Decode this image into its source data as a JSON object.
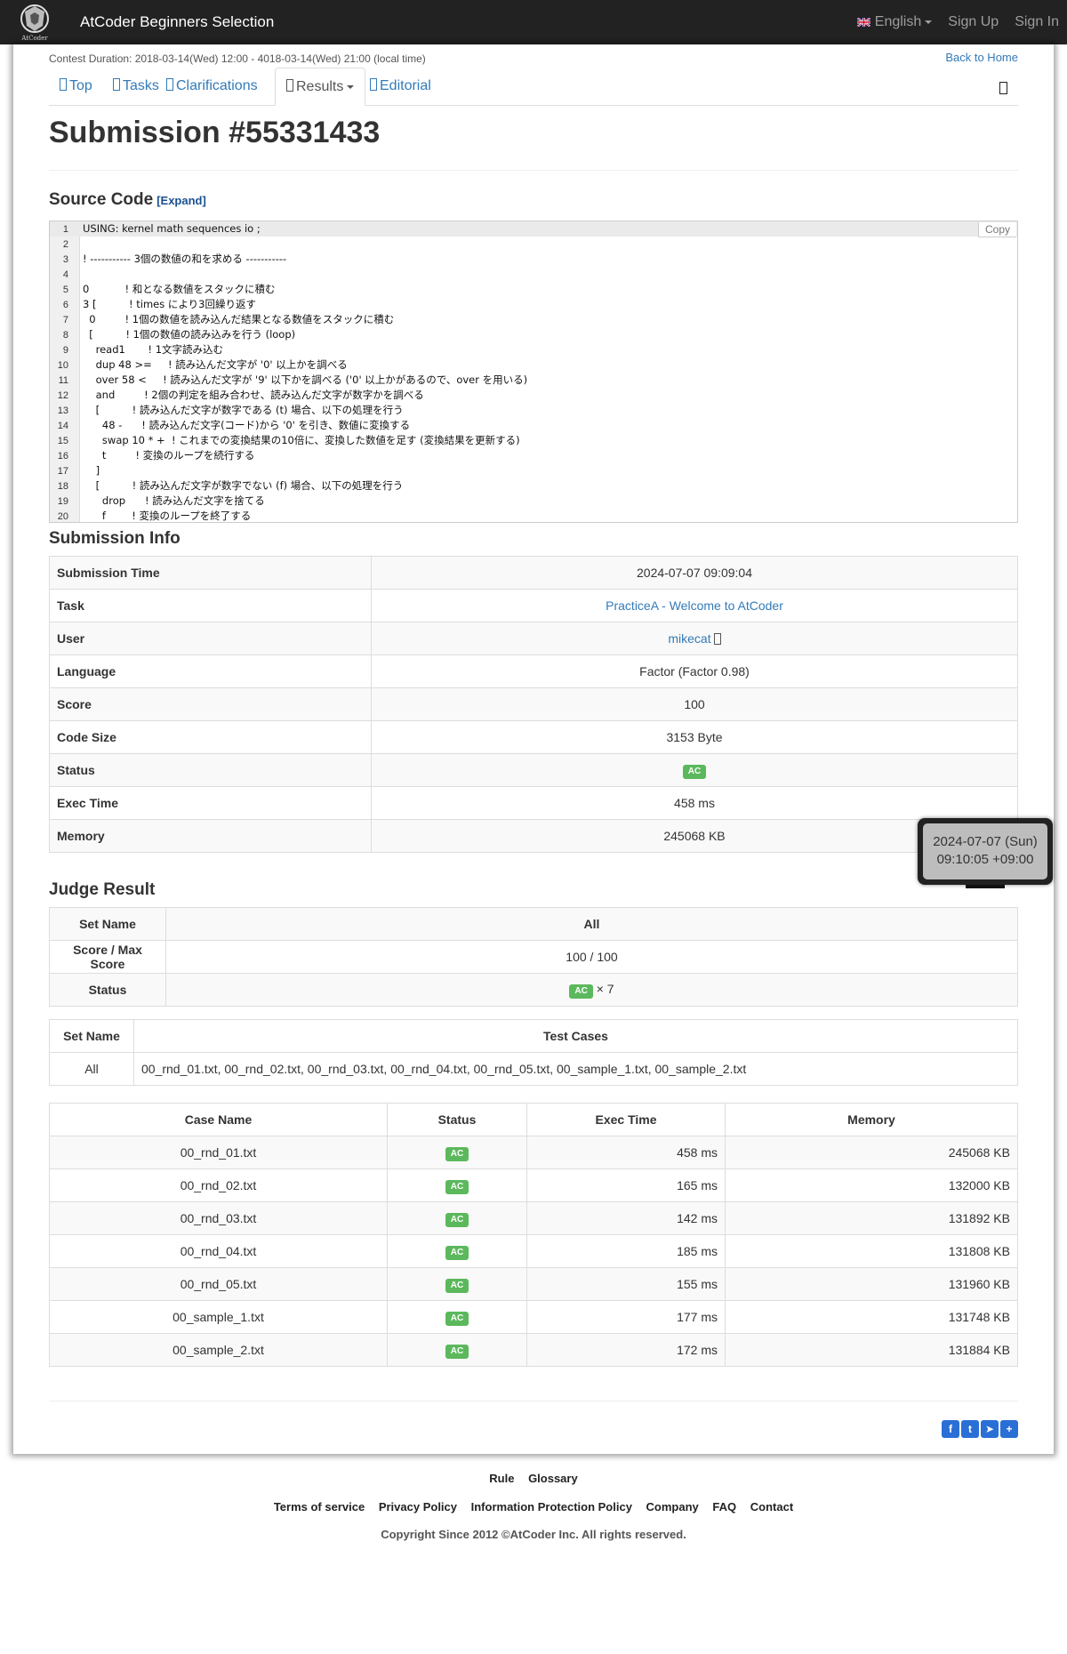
{
  "navbar": {
    "brand": "AtCoder Beginners Selection",
    "logo_text": "AtCoder",
    "language": "English",
    "sign_up": "Sign Up",
    "sign_in": "Sign In"
  },
  "contest": {
    "duration": "Contest Duration: 2018-03-14(Wed) 12:00 - 4018-03-14(Wed) 21:00 (local time)",
    "back_home": "Back to Home"
  },
  "tabs": [
    "Top",
    "Tasks",
    "Clarifications",
    "Results",
    "Editorial"
  ],
  "title": "Submission #55331433",
  "source": {
    "heading": "Source Code",
    "expand": "[Expand]",
    "copy": "Copy",
    "lines": [
      {
        "n": "1",
        "t": "USING: kernel math sequences io ;"
      },
      {
        "n": "2",
        "t": ""
      },
      {
        "n": "3",
        "t": "! ----------- 3個の数値の和を求める -----------"
      },
      {
        "n": "4",
        "t": ""
      },
      {
        "n": "5",
        "t": "0           ! 和となる数値をスタックに積む"
      },
      {
        "n": "6",
        "t": "3 [          ! times により3回繰り返す"
      },
      {
        "n": "7",
        "t": "  0         ! 1個の数値を読み込んだ結果となる数値をスタックに積む"
      },
      {
        "n": "8",
        "t": "  [          ! 1個の数値の読み込みを行う (loop)"
      },
      {
        "n": "9",
        "t": "    read1       ! 1文字読み込む"
      },
      {
        "n": "10",
        "t": "    dup 48 >=     ! 読み込んだ文字が '0' 以上かを調べる"
      },
      {
        "n": "11",
        "t": "    over 58 <     ! 読み込んだ文字が '9' 以下かを調べる ('0' 以上かがあるので、over を用いる)"
      },
      {
        "n": "12",
        "t": "    and         ! 2個の判定を組み合わせ、読み込んだ文字が数字かを調べる"
      },
      {
        "n": "13",
        "t": "    [          ! 読み込んだ文字が数字である (t) 場合、以下の処理を行う"
      },
      {
        "n": "14",
        "t": "      48 -      ! 読み込んだ文字(コード)から '0' を引き、数値に変換する"
      },
      {
        "n": "15",
        "t": "      swap 10 * +  ! これまでの変換結果の10倍に、変換した数値を足す (変換結果を更新する)"
      },
      {
        "n": "16",
        "t": "      t         ! 変換のループを続行する"
      },
      {
        "n": "17",
        "t": "    ]"
      },
      {
        "n": "18",
        "t": "    [          ! 読み込んだ文字が数字でない (f) 場合、以下の処理を行う"
      },
      {
        "n": "19",
        "t": "      drop      ! 読み込んだ文字を捨てる"
      },
      {
        "n": "20",
        "t": "      f        ! 変換のループを終了する"
      }
    ]
  },
  "info": {
    "heading": "Submission Info",
    "rows": [
      {
        "k": "Submission Time",
        "v": "2024-07-07 09:09:04"
      },
      {
        "k": "Task",
        "v": "PracticeA - Welcome to AtCoder"
      },
      {
        "k": "User",
        "v": "mikecat"
      },
      {
        "k": "Language",
        "v": "Factor (Factor 0.98)"
      },
      {
        "k": "Score",
        "v": "100"
      },
      {
        "k": "Code Size",
        "v": "3153 Byte"
      },
      {
        "k": "Status",
        "v": "AC"
      },
      {
        "k": "Exec Time",
        "v": "458 ms"
      },
      {
        "k": "Memory",
        "v": "245068 KB"
      }
    ]
  },
  "tooltip": {
    "line1": "2024-07-07 (Sun)",
    "line2": "09:10:05 +09:00"
  },
  "judge": {
    "heading": "Judge Result",
    "set_name_label": "Set Name",
    "set_all": "All",
    "score_label": "Score / Max Score",
    "score_value": "100 / 100",
    "status_label": "Status",
    "status_value": "AC",
    "status_count": "× 7"
  },
  "testsets": {
    "set_name_label": "Set Name",
    "test_cases_label": "Test Cases",
    "set": "All",
    "cases": "00_rnd_01.txt, 00_rnd_02.txt, 00_rnd_03.txt, 00_rnd_04.txt, 00_rnd_05.txt, 00_sample_1.txt, 00_sample_2.txt"
  },
  "cases": {
    "headers": [
      "Case Name",
      "Status",
      "Exec Time",
      "Memory"
    ],
    "rows": [
      {
        "name": "00_rnd_01.txt",
        "status": "AC",
        "time": "458 ms",
        "mem": "245068 KB"
      },
      {
        "name": "00_rnd_02.txt",
        "status": "AC",
        "time": "165 ms",
        "mem": "132000 KB"
      },
      {
        "name": "00_rnd_03.txt",
        "status": "AC",
        "time": "142 ms",
        "mem": "131892 KB"
      },
      {
        "name": "00_rnd_04.txt",
        "status": "AC",
        "time": "185 ms",
        "mem": "131808 KB"
      },
      {
        "name": "00_rnd_05.txt",
        "status": "AC",
        "time": "155 ms",
        "mem": "131960 KB"
      },
      {
        "name": "00_sample_1.txt",
        "status": "AC",
        "time": "177 ms",
        "mem": "131748 KB"
      },
      {
        "name": "00_sample_2.txt",
        "status": "AC",
        "time": "172 ms",
        "mem": "131884 KB"
      }
    ]
  },
  "footer": {
    "row1": [
      "Rule",
      "Glossary"
    ],
    "row2": [
      "Terms of service",
      "Privacy Policy",
      "Information Protection Policy",
      "Company",
      "FAQ",
      "Contact"
    ],
    "copyright": "Copyright Since 2012 ©AtCoder Inc. All rights reserved."
  },
  "colors": {
    "navbar": "#222222",
    "link": "#337ab7",
    "ac": "#5cb85c"
  }
}
